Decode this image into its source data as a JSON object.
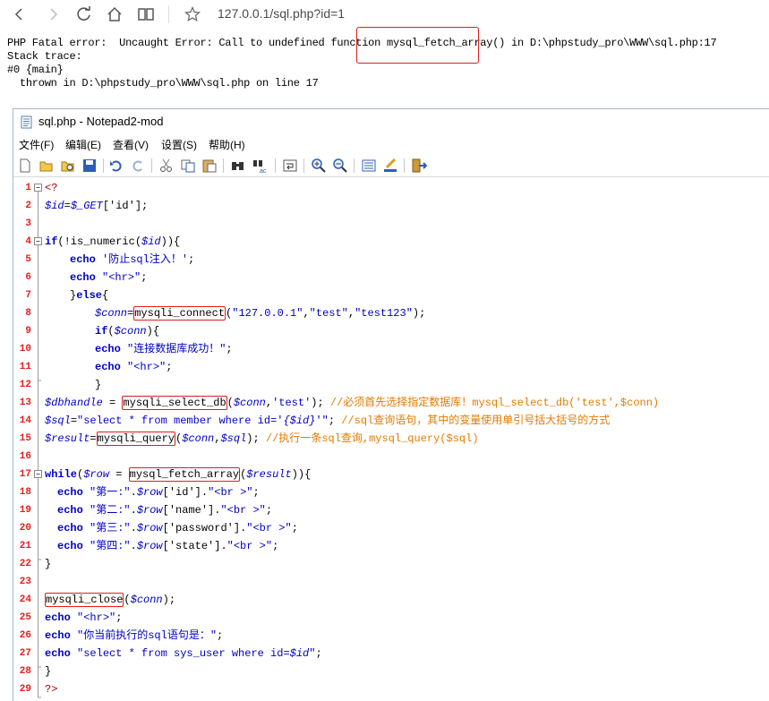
{
  "browser": {
    "url": "127.0.0.1/sql.php?id=1",
    "icons": [
      "back-icon",
      "forward-icon",
      "reload-icon",
      "home-icon",
      "reading-view-icon",
      "favorite-star-icon"
    ]
  },
  "php_error": {
    "line1_a": "PHP Fatal error:  Uncaught Error: Call to undefined function ",
    "line1_fn": "mysql_fetch_array()",
    "line1_b": " in D:\\phpstudy_pro\\WWW\\sql.php:17",
    "line2": "Stack trace:",
    "line3": "#0 {main}",
    "line4": "  thrown in D:\\phpstudy_pro\\WWW\\sql.php on line 17"
  },
  "editor": {
    "title": "sql.php - Notepad2-mod",
    "menu": [
      "文件(F)",
      "编辑(E)",
      "查看(V)",
      "设置(S)",
      "帮助(H)"
    ],
    "toolbar": [
      "new-file-icon",
      "open-file-icon",
      "browse-icon",
      "save-icon",
      "undo-icon",
      "redo-icon",
      "cut-icon",
      "copy-icon",
      "paste-icon",
      "find-icon",
      "replace-icon",
      "wrap-icon",
      "zoom-in-icon",
      "zoom-out-icon",
      "scheme-icon",
      "customize-icon",
      "exit-icon"
    ],
    "line_numbers": [
      "1",
      "2",
      "3",
      "4",
      "5",
      "6",
      "7",
      "8",
      "9",
      "10",
      "11",
      "12",
      "13",
      "14",
      "15",
      "16",
      "17",
      "18",
      "19",
      "20",
      "21",
      "22",
      "23",
      "24",
      "25",
      "26",
      "27",
      "28",
      "29"
    ],
    "code": {
      "l1": "<?",
      "l2_var": "$id",
      "l2_eq": "=",
      "l2_get": "$_GET",
      "l2_rest": "['id'];",
      "l4_kw": "if",
      "l4_a": "(!is_numeric(",
      "l4_var": "$id",
      "l4_b": ")){",
      "l5_kw": "echo",
      "l5_str": "'防止sql注入！'",
      "l5_end": ";",
      "l6_kw": "echo",
      "l6_str": "\"<hr>\"",
      "l6_end": ";",
      "l7_a": "}",
      "l7_kw": "else",
      "l7_b": "{",
      "l8_var": "$conn",
      "l8_eq": "=",
      "l8_fn": "mysqli_connect",
      "l8_a": "(",
      "l8_s1": "\"127.0.0.1\"",
      "l8_c1": ",",
      "l8_s2": "\"test\"",
      "l8_c2": ",",
      "l8_s3": "\"test123\"",
      "l8_end": ");",
      "l9_kw": "if",
      "l9_a": "(",
      "l9_var": "$conn",
      "l9_b": "){",
      "l10_kw": "echo",
      "l10_str": "\"连接数据库成功！\"",
      "l10_end": ";",
      "l11_kw": "echo",
      "l11_str": "\"<hr>\"",
      "l11_end": ";",
      "l12": "}",
      "l13_var": "$dbhandle",
      "l13_eq": " = ",
      "l13_fn": "mysqli_select_db",
      "l13_a": "(",
      "l13_var2": "$conn",
      "l13_b": ",",
      "l13_str": "'test'",
      "l13_c": "); ",
      "l13_cm": "//必须首先选择指定数据库！mysql_select_db('test',$conn)",
      "l14_var": "$sql",
      "l14_eq": "=",
      "l14_s1": "\"select * from member where id='",
      "l14_var2": "{$id}",
      "l14_s2": "'\"",
      "l14_end": "; ",
      "l14_cm": "//sql查询语句，其中的变量使用单引号括大括号的方式",
      "l15_var": "$result",
      "l15_eq": "=",
      "l15_fn": "mysqli_query",
      "l15_a": "(",
      "l15_v1": "$conn",
      "l15_c": ",",
      "l15_v2": "$sql",
      "l15_end": "); ",
      "l15_cm": "//执行一条sql查询,mysql_query($sql)",
      "l17_kw": "while",
      "l17_a": "(",
      "l17_var": "$row",
      "l17_eq": " = ",
      "l17_fn": "mysql_fetch_array",
      "l17_b": "(",
      "l17_var2": "$result",
      "l17_c": ")){",
      "l18_kw": "echo",
      "l18_s1": "\"第一:\"",
      "l18_d1": ".",
      "l18_var": "$row",
      "l18_idx": "['id']",
      "l18_d2": ".",
      "l18_s2": "\"<br >\"",
      "l18_end": ";",
      "l19_kw": "echo",
      "l19_s1": "\"第二:\"",
      "l19_d1": ".",
      "l19_var": "$row",
      "l19_idx": "['name']",
      "l19_d2": ".",
      "l19_s2": "\"<br >\"",
      "l19_end": ";",
      "l20_kw": "echo",
      "l20_s1": "\"第三:\"",
      "l20_d1": ".",
      "l20_var": "$row",
      "l20_idx": "['password']",
      "l20_d2": ".",
      "l20_s2": "\"<br >\"",
      "l20_end": ";",
      "l21_kw": "echo",
      "l21_s1": "\"第四:\"",
      "l21_d1": ".",
      "l21_var": "$row",
      "l21_idx": "['state']",
      "l21_d2": ".",
      "l21_s2": "\"<br >\"",
      "l21_end": ";",
      "l22": "}",
      "l24_fn": "mysqli_close",
      "l24_a": "(",
      "l24_var": "$conn",
      "l24_end": ");",
      "l25_kw": "echo",
      "l25_str": "\"<hr>\"",
      "l25_end": ";",
      "l26_kw": "echo",
      "l26_str": "\"你当前执行的sql语句是：\"",
      "l26_end": ";",
      "l27_kw": "echo",
      "l27_s1": "\"select * from sys_user where id=",
      "l27_var": "$id",
      "l27_s2": "\"",
      "l27_end": ";",
      "l28": "}",
      "l29": "?>"
    }
  },
  "colors": {
    "error_highlight": "#e21c1c",
    "line_numbers": "#e81b1b",
    "keyword": "#0000c8",
    "comment": "#e57b00"
  }
}
